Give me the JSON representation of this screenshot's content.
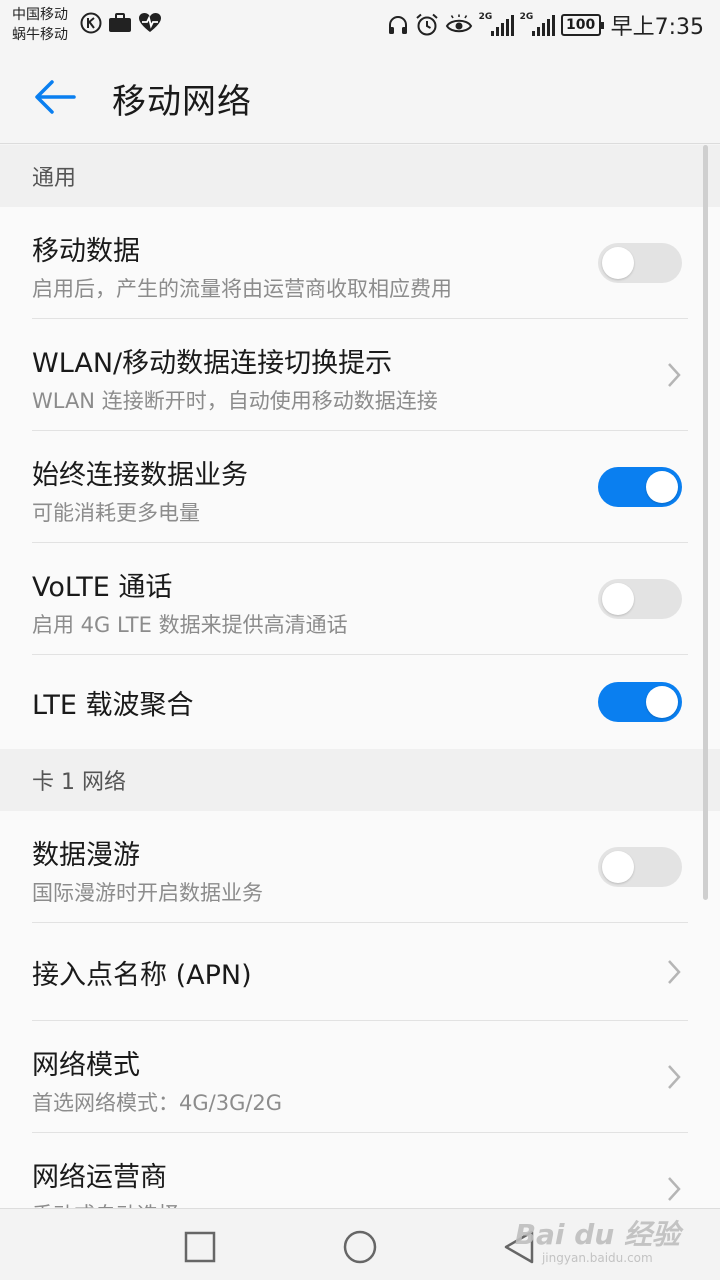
{
  "status_bar": {
    "carrier_1": "中国移动",
    "carrier_2": "蜗牛移动",
    "network_gen": "2G",
    "battery": "100",
    "time": "早上7:35"
  },
  "app_bar": {
    "title": "移动网络"
  },
  "sections": {
    "general": {
      "header": "通用",
      "mobile_data": {
        "title": "移动数据",
        "subtitle": "启用后，产生的流量将由运营商收取相应费用",
        "enabled": false
      },
      "wlan_switch_prompt": {
        "title": "WLAN/移动数据连接切换提示",
        "subtitle": "WLAN 连接断开时，自动使用移动数据连接"
      },
      "always_on_data": {
        "title": "始终连接数据业务",
        "subtitle": "可能消耗更多电量",
        "enabled": true
      },
      "volte": {
        "title": "VoLTE 通话",
        "subtitle": "启用 4G LTE 数据来提供高清通话",
        "enabled": false
      },
      "lte_ca": {
        "title": "LTE 载波聚合",
        "enabled": true
      }
    },
    "sim1": {
      "header": "卡 1 网络",
      "data_roaming": {
        "title": "数据漫游",
        "subtitle": "国际漫游时开启数据业务",
        "enabled": false
      },
      "apn": {
        "title": "接入点名称 (APN)"
      },
      "network_mode": {
        "title": "网络模式",
        "subtitle": "首选网络模式：4G/3G/2G"
      },
      "carrier": {
        "title": "网络运营商",
        "subtitle": "手动或自动选择"
      }
    }
  },
  "watermark": {
    "main": "Bai du 经验",
    "sub": "jingyan.baidu.com"
  },
  "colors": {
    "accent": "#0a7ff0",
    "switch_off": "#e3e3e3"
  }
}
